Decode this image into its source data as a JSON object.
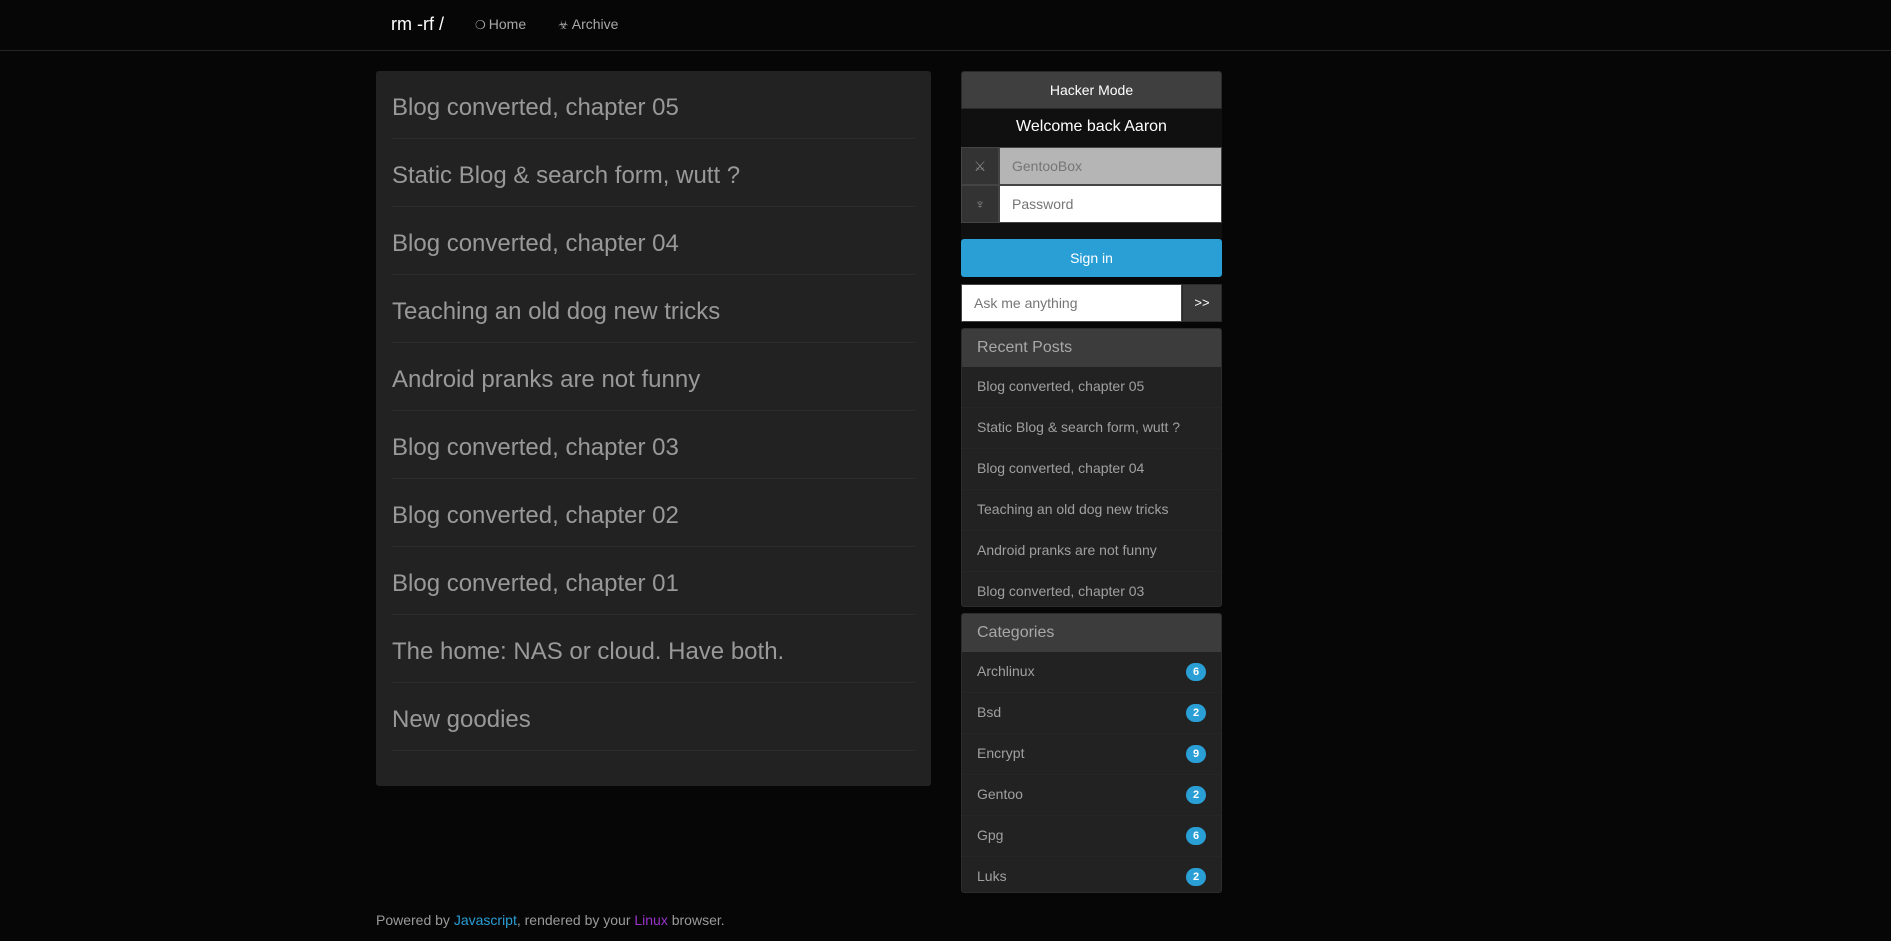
{
  "navbar": {
    "brand": "rm -rf /",
    "links": [
      {
        "icon": "circle-icon",
        "glyph": "❍",
        "label": "Home"
      },
      {
        "icon": "biohazard-icon",
        "glyph": "☣",
        "label": "Archive"
      }
    ]
  },
  "posts": [
    "Blog converted, chapter 05",
    "Static Blog & search form, wutt ?",
    "Blog converted, chapter 04",
    "Teaching an old dog new tricks",
    "Android pranks are not funny",
    "Blog converted, chapter 03",
    "Blog converted, chapter 02",
    "Blog converted, chapter 01",
    "The home: NAS or cloud. Have both.",
    "New goodies"
  ],
  "sidebar": {
    "mode_button": "Hacker Mode",
    "welcome": "Welcome back Aaron",
    "username": {
      "icon": "sword-icon",
      "glyph": "⚔",
      "placeholder": "GentooBox"
    },
    "password": {
      "icon": "trident-icon",
      "glyph": "♆",
      "placeholder": "Password"
    },
    "signin_label": "Sign in",
    "search": {
      "placeholder": "Ask me anything",
      "button": ">>"
    },
    "recent": {
      "title": "Recent Posts",
      "items": [
        "Blog converted, chapter 05",
        "Static Blog & search form, wutt ?",
        "Blog converted, chapter 04",
        "Teaching an old dog new tricks",
        "Android pranks are not funny",
        "Blog converted, chapter 03"
      ]
    },
    "categories": {
      "title": "Categories",
      "items": [
        {
          "name": "Archlinux",
          "count": "6"
        },
        {
          "name": "Bsd",
          "count": "2"
        },
        {
          "name": "Encrypt",
          "count": "9"
        },
        {
          "name": "Gentoo",
          "count": "2"
        },
        {
          "name": "Gpg",
          "count": "6"
        },
        {
          "name": "Luks",
          "count": "2"
        }
      ]
    }
  },
  "footer": {
    "prefix": "Powered by ",
    "link1": "Javascript",
    "middle": ", rendered by your ",
    "link2": "Linux",
    "suffix": " browser.",
    "link1_color": "#2a9fd6",
    "link2_color": "#9933cc"
  },
  "colors": {
    "accent": "#2a9fd6",
    "background": "#060606",
    "panel": "#222222"
  }
}
